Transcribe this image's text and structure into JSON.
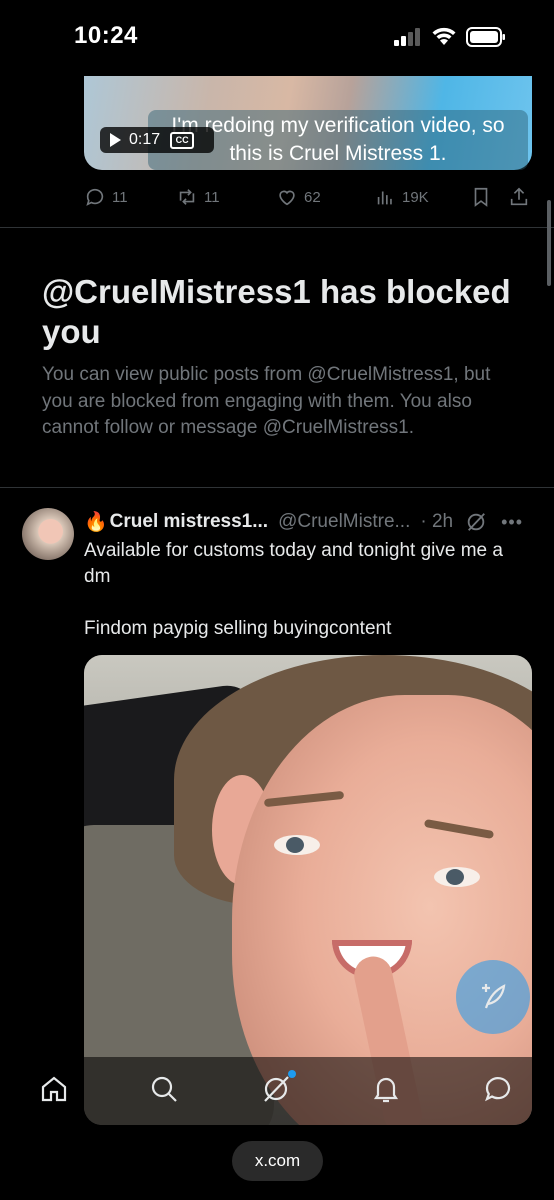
{
  "status_bar": {
    "time": "10:24"
  },
  "video_post": {
    "caption": "I'm redoing my verification video, so this is Cruel Mistress 1.",
    "duration": "0:17",
    "cc_label": "CC",
    "actions": {
      "replies": "11",
      "reposts": "11",
      "likes": "62",
      "views": "19K"
    }
  },
  "blocked_notice": {
    "title": "@CruelMistress1 has blocked you",
    "description": "You can view public posts from @CruelMistress1, but you are blocked from engaging with them. You also cannot follow or message @CruelMistress1."
  },
  "second_post": {
    "flame": "🔥",
    "author": "Cruel mistress1...",
    "handle": "@CruelMistre...",
    "time": "· 2h",
    "more": "•••",
    "text": "Available for customs today and tonight give me a dm\n\nFindom paypig selling buyingcontent"
  },
  "bottom_nav": {
    "items": [
      "home-icon",
      "search-icon",
      "grok-icon",
      "notifications-icon",
      "messages-icon"
    ]
  },
  "browser": {
    "url": "x.com"
  },
  "colors": {
    "accent": "#1d9bf0",
    "muted": "#71767b",
    "text": "#e7e9ea",
    "background": "#000000"
  }
}
